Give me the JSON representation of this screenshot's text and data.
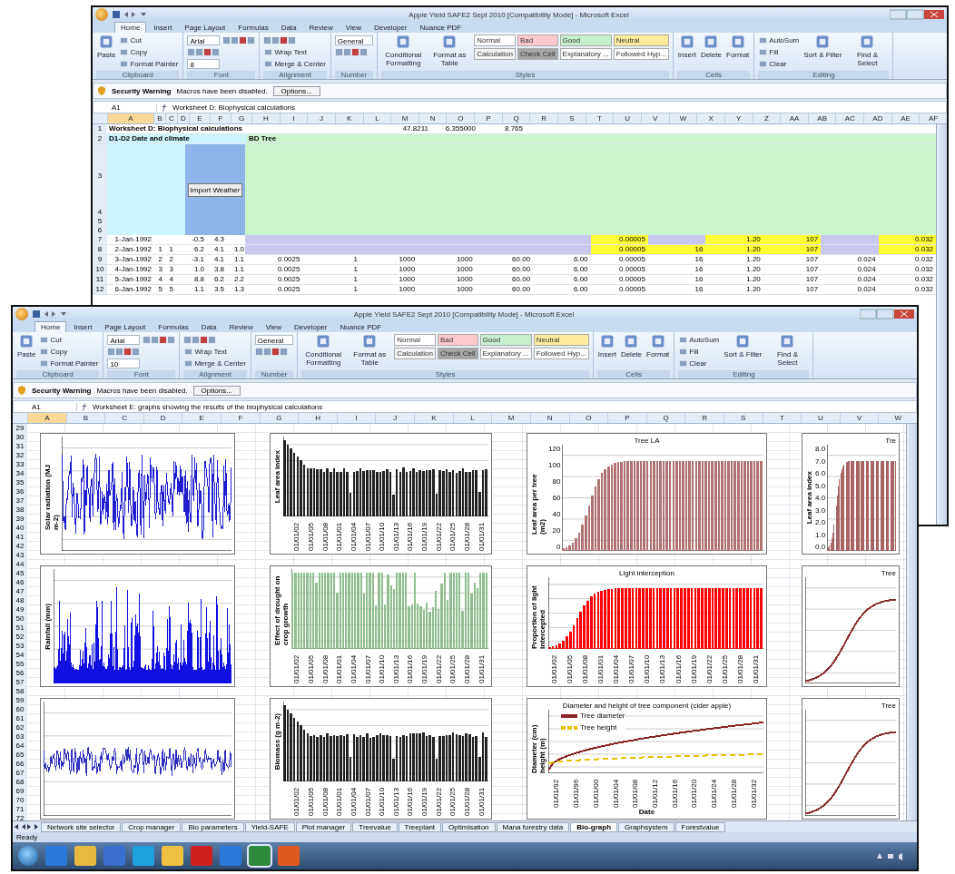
{
  "windows": [
    {
      "kind": "worksheet",
      "title": "Apple Yield SAFE2 Sept 2010 [Compatibility Mode] - Microsoft Excel",
      "tabs": [
        {
          "label": "Home",
          "selected": true
        },
        {
          "label": "Insert",
          "selected": false
        },
        {
          "label": "Page Layout",
          "selected": false
        },
        {
          "label": "Formulas",
          "selected": false
        },
        {
          "label": "Data",
          "selected": false
        },
        {
          "label": "Review",
          "selected": false
        },
        {
          "label": "View",
          "selected": false
        },
        {
          "label": "Developer",
          "selected": false
        },
        {
          "label": "Nuance PDF",
          "selected": false
        }
      ],
      "ribbon": [
        {
          "label": "Clipboard",
          "items": [
            {
              "kind": "big",
              "text": "Paste"
            },
            {
              "kind": "small",
              "text": "Cut"
            },
            {
              "kind": "small",
              "text": "Copy"
            },
            {
              "kind": "small",
              "text": "Format Painter"
            }
          ]
        },
        {
          "label": "Font",
          "items": [
            {
              "kind": "field",
              "text": "Arial"
            },
            {
              "kind": "small"
            },
            {
              "kind": "field",
              "text": "8"
            },
            {
              "kind": "small"
            }
          ]
        },
        {
          "label": "Alignment",
          "items": [
            {
              "kind": "small"
            },
            {
              "kind": "small",
              "text": "Wrap Text"
            },
            {
              "kind": "small",
              "text": "Merge & Center"
            }
          ]
        },
        {
          "label": "Number",
          "items": [
            {
              "kind": "field",
              "text": "General"
            },
            {
              "kind": "small"
            }
          ]
        },
        {
          "label": "Styles",
          "items": [
            {
              "kind": "big",
              "text": "Conditional Formatting"
            },
            {
              "kind": "big",
              "text": "Format as Table"
            }
          ],
          "styles": [
            {
              "text": "Normal",
              "color": "#ffffff"
            },
            {
              "text": "Bad",
              "color": "#ffc7ce"
            },
            {
              "text": "Good",
              "color": "#c6efce"
            },
            {
              "text": "Neutral",
              "color": "#ffeb9c"
            },
            {
              "text": "Calculation",
              "color": "#f2f2f2"
            },
            {
              "text": "Check Cell",
              "color": "#a5a5a5"
            },
            {
              "text": "Explanatory ...",
              "color": "#fafafa"
            },
            {
              "text": "Followed Hyp...",
              "color": "#fdfdfd"
            }
          ]
        },
        {
          "label": "Cells",
          "items": [
            {
              "kind": "big",
              "text": "Insert"
            },
            {
              "kind": "big",
              "text": "Delete"
            },
            {
              "kind": "big",
              "text": "Format"
            }
          ]
        },
        {
          "label": "Editing",
          "items": [
            {
              "kind": "small",
              "text": "AutoSum"
            },
            {
              "kind": "small",
              "text": "Fill"
            },
            {
              "kind": "small",
              "text": "Clear"
            },
            {
              "kind": "big",
              "text": "Sort & Filter"
            },
            {
              "kind": "big",
              "text": "Find & Select"
            }
          ]
        }
      ],
      "security": {
        "title": "Security Warning",
        "message": "Macros have been disabled.",
        "button": "Options..."
      },
      "name_box": "A1",
      "formula": "Worksheet D: Biophysical calculations",
      "columns": [
        "A",
        "B",
        "C",
        "D",
        "E",
        "F",
        "G",
        "H",
        "I",
        "J",
        "K",
        "L",
        "M",
        "N",
        "O",
        "P",
        "Q",
        "R",
        "S",
        "T",
        "U",
        "V",
        "W",
        "X",
        "Y",
        "Z",
        "AA",
        "AB",
        "AC",
        "AD",
        "AE",
        "AF"
      ],
      "sheet": {
        "header_row_numbers": [
          "1",
          "2",
          "3",
          "4",
          "5",
          "6"
        ],
        "title": "Worksheet D: Biophysical calculations",
        "totals": [
          "47.8211",
          "6.355000",
          "8.765"
        ],
        "climate_heading": "D1-D2 Date and climate",
        "tree_heading": "BD Tree",
        "import_button": "Import Weather",
        "rows": [
          {
            "number": "7",
            "date": "1-Jan-1992",
            "temp": "-0.5",
            "rad": "4.3",
            "highlight": true,
            "tree": {
              "column_7": "0.00005",
              "column_9": "1.20",
              "column_10": "107",
              "column_12": "0.032"
            }
          },
          {
            "number": "8",
            "date": "2-Jan-1992",
            "day": "1",
            "doy": "1",
            "temp": "6.2",
            "rad": "4.1",
            "precip": "1.0",
            "highlight": true,
            "tree": {
              "column_7": "0.00005",
              "column_8": "16",
              "column_9": "1.20",
              "column_10": "107",
              "column_12": "0.032"
            }
          },
          {
            "number": "9",
            "date": "3-Jan-1992",
            "day": "2",
            "doy": "2",
            "temp": "-3.1",
            "rad": "4.1",
            "precip": "1.1",
            "highlight": false,
            "tree": {
              "column_1": "0.0025",
              "column_2": "1",
              "column_3": "1000",
              "column_4": "1000",
              "column_5": "60.00",
              "column_6": "6.00",
              "column_7": "0.00005",
              "column_8": "16",
              "column_9": "1.20",
              "column_10": "107",
              "column_11": "0.024",
              "column_12": "0.032"
            }
          },
          {
            "number": "10",
            "date": "4-Jan-1992",
            "day": "3",
            "doy": "3",
            "temp": "1.0",
            "rad": "3.8",
            "precip": "1.1",
            "highlight": false,
            "tree": {
              "column_1": "0.0025",
              "column_2": "1",
              "column_3": "1000",
              "column_4": "1000",
              "column_5": "60.00",
              "column_6": "6.00",
              "column_7": "0.00005",
              "column_8": "16",
              "column_9": "1.20",
              "column_10": "107",
              "column_11": "0.024",
              "column_12": "0.032"
            }
          },
          {
            "number": "11",
            "date": "5-Jan-1992",
            "day": "4",
            "doy": "4",
            "temp": "8.8",
            "rad": "6.2",
            "precip": "2.2",
            "highlight": false,
            "tree": {
              "column_1": "0.0025",
              "column_2": "1",
              "column_3": "1000",
              "column_4": "1000",
              "column_5": "60.00",
              "column_6": "6.00",
              "column_7": "0.00005",
              "column_8": "16",
              "column_9": "1.20",
              "column_10": "107",
              "column_11": "0.024",
              "column_12": "0.032"
            }
          },
          {
            "number": "12",
            "date": "6-Jan-1992",
            "day": "5",
            "doy": "5",
            "temp": "1.1",
            "rad": "3.5",
            "precip": "1.3",
            "highlight": false,
            "tree": {
              "column_1": "0.0025",
              "column_2": "1",
              "column_3": "1000",
              "column_4": "1000",
              "column_5": "60.00",
              "column_6": "6.00",
              "column_7": "0.00005",
              "column_8": "16",
              "column_9": "1.20",
              "column_10": "107",
              "column_11": "0.024",
              "column_12": "0.032"
            }
          }
        ]
      }
    },
    {
      "kind": "graphs",
      "title": "Apple Yield SAFE2 Sept 2010 [Compatibility Mode] - Microsoft Excel",
      "tabs": [
        {
          "label": "Home",
          "selected": true
        },
        {
          "label": "Insert",
          "selected": false
        },
        {
          "label": "Page Layout",
          "selected": false
        },
        {
          "label": "Formulas",
          "selected": false
        },
        {
          "label": "Data",
          "selected": false
        },
        {
          "label": "Review",
          "selected": false
        },
        {
          "label": "View",
          "selected": false
        },
        {
          "label": "Developer",
          "selected": false
        },
        {
          "label": "Nuance PDF",
          "selected": false
        }
      ],
      "ribbon": [
        {
          "label": "Clipboard",
          "items": [
            {
              "kind": "big",
              "text": "Paste"
            },
            {
              "kind": "small",
              "text": "Cut"
            },
            {
              "kind": "small",
              "text": "Copy"
            },
            {
              "kind": "small",
              "text": "Format Painter"
            }
          ]
        },
        {
          "label": "Font",
          "items": [
            {
              "kind": "field",
              "text": "Arial"
            },
            {
              "kind": "small"
            },
            {
              "kind": "field",
              "text": "10"
            },
            {
              "kind": "small"
            }
          ]
        },
        {
          "label": "Alignment",
          "items": [
            {
              "kind": "small"
            },
            {
              "kind": "small",
              "text": "Wrap Text"
            },
            {
              "kind": "small",
              "text": "Merge & Center"
            }
          ]
        },
        {
          "label": "Number",
          "items": [
            {
              "kind": "field",
              "text": "General"
            },
            {
              "kind": "small"
            }
          ]
        },
        {
          "label": "Styles",
          "items": [
            {
              "kind": "big",
              "text": "Conditional Formatting"
            },
            {
              "kind": "big",
              "text": "Format as Table"
            }
          ],
          "styles": [
            {
              "text": "Normal",
              "color": "#ffffff"
            },
            {
              "text": "Bad",
              "color": "#ffc7ce"
            },
            {
              "text": "Good",
              "color": "#c6efce"
            },
            {
              "text": "Neutral",
              "color": "#ffeb9c"
            },
            {
              "text": "Calculation",
              "color": "#f2f2f2"
            },
            {
              "text": "Check Cell",
              "color": "#a5a5a5"
            },
            {
              "text": "Explanatory ...",
              "color": "#fafafa"
            },
            {
              "text": "Followed Hyp...",
              "color": "#fdfdfd"
            }
          ]
        },
        {
          "label": "Cells",
          "items": [
            {
              "kind": "big",
              "text": "Insert"
            },
            {
              "kind": "big",
              "text": "Delete"
            },
            {
              "kind": "big",
              "text": "Format"
            }
          ]
        },
        {
          "label": "Editing",
          "items": [
            {
              "kind": "small",
              "text": "AutoSum"
            },
            {
              "kind": "small",
              "text": "Fill"
            },
            {
              "kind": "small",
              "text": "Clear"
            },
            {
              "kind": "big",
              "text": "Sort & Filter"
            },
            {
              "kind": "big",
              "text": "Find & Select"
            }
          ]
        }
      ],
      "security": {
        "title": "Security Warning",
        "message": "Macros have been disabled.",
        "button": "Options..."
      },
      "name_box": "A1",
      "formula": "Worksheet E: graphs showing the results of the biophysical calculations",
      "columns": [
        "A",
        "B",
        "C",
        "D",
        "E",
        "F",
        "G",
        "H",
        "I",
        "J",
        "K",
        "L",
        "M",
        "N",
        "O",
        "P",
        "Q",
        "R",
        "S",
        "T",
        "U",
        "V",
        "W"
      ],
      "row_numbers": [
        "29",
        "30",
        "31",
        "32",
        "33",
        "34",
        "35",
        "36",
        "37",
        "38",
        "39",
        "40",
        "41",
        "42",
        "43",
        "44",
        "45",
        "46",
        "47",
        "48",
        "49",
        "50",
        "51",
        "52",
        "53",
        "54",
        "55",
        "56",
        "57",
        "58",
        "59",
        "60",
        "61",
        "62",
        "63",
        "64",
        "65",
        "66",
        "67",
        "68",
        "69",
        "70",
        "71",
        "72"
      ],
      "charts": [
        {
          "kind": "noisy-line",
          "color": "#1f1fd0",
          "ylabel": "Solar radiation (MJ m-2)"
        },
        {
          "kind": "bars",
          "color": "#222222",
          "ylabel": "Leaf area index",
          "x_labels": [
            "01/01/02",
            "01/01/05",
            "01/01/08",
            "01/01/01",
            "01/01/04",
            "01/01/07",
            "01/01/10",
            "01/01/13",
            "01/01/16",
            "01/01/19",
            "01/01/22",
            "01/01/25",
            "01/01/28",
            "01/01/31"
          ]
        },
        {
          "kind": "growth-bars",
          "color": "#b07272",
          "title": "Tree LA",
          "ylabel": "Leaf area per tree (m2)",
          "y_ticks": [
            "120",
            "100",
            "80",
            "60",
            "40",
            "20",
            "0"
          ]
        },
        {
          "kind": "growth-bars",
          "color": "#a86464",
          "title": "Tre",
          "ylabel": "Leaf area index",
          "y_ticks": [
            "8.0",
            "7.0",
            "6.0",
            "5.0",
            "4.0",
            "3.0",
            "2.0",
            "1.0",
            "0.0"
          ]
        },
        {
          "kind": "spiky-line",
          "color": "#1010e0",
          "ylabel": "Rainfall (mm)"
        },
        {
          "kind": "dense-bars",
          "color": "#8fbf8f",
          "ylabel": "Effect of drought on crop growth",
          "x_labels": [
            "01/01/02",
            "01/01/05",
            "01/01/08",
            "01/01/01",
            "01/01/04",
            "01/01/07",
            "01/01/10",
            "01/01/13",
            "01/01/16",
            "01/01/19",
            "01/01/22",
            "01/01/25",
            "01/01/28",
            "01/01/31"
          ]
        },
        {
          "kind": "growth-bars",
          "color": "#ff0000",
          "title": "Light interception",
          "ylabel": "Proportion of light intercepted",
          "x_labels": [
            "01/01/02",
            "01/01/05",
            "01/01/08",
            "01/01/01",
            "01/01/04",
            "01/01/07",
            "01/01/10",
            "01/01/13",
            "01/01/16",
            "01/01/19",
            "01/01/22",
            "01/01/25",
            "01/01/28",
            "01/01/31"
          ]
        },
        {
          "kind": "growth-line",
          "color": "#8b3030",
          "title": "Tree"
        },
        {
          "kind": "noisy-band",
          "color": "#3030c0"
        },
        {
          "kind": "bars",
          "color": "#222222",
          "ylabel": "Biomass (g m-2)",
          "x_labels": [
            "01/01/02",
            "01/01/05",
            "01/01/08",
            "01/01/01",
            "01/01/04",
            "01/01/07",
            "01/01/10",
            "01/01/13",
            "01/01/16",
            "01/01/19",
            "01/01/22",
            "01/01/25",
            "01/01/28",
            "01/01/31"
          ]
        },
        {
          "kind": "two-lines",
          "title": "Diameter and height of tree component (cider apple)",
          "ylabel": "Diameter (cm) height (m)",
          "xlabel": "Date",
          "legend": [
            {
              "label": "Tree diameter",
              "color": "#8b2525",
              "dashed": false
            },
            {
              "label": "Tree height",
              "color": "#e6c200",
              "dashed": true
            }
          ],
          "x_labels": [
            "01/01/92",
            "01/01/96",
            "01/01/00",
            "01/01/04",
            "01/01/08",
            "01/01/12",
            "01/01/16",
            "01/01/20",
            "01/01/24",
            "01/01/28",
            "01/01/32"
          ]
        },
        {
          "kind": "growth-line",
          "color": "#8b3030",
          "title": "Tree"
        }
      ],
      "sheet_tabs": [
        {
          "label": "Network site selector",
          "selected": false
        },
        {
          "label": "Crop manager",
          "selected": false
        },
        {
          "label": "Bio parameters",
          "selected": false
        },
        {
          "label": "Yield-SAFE",
          "selected": false
        },
        {
          "label": "Plot manager",
          "selected": false
        },
        {
          "label": "Treevalue",
          "selected": false
        },
        {
          "label": "Treeplant",
          "selected": false
        },
        {
          "label": "Optimisation",
          "selected": false
        },
        {
          "label": "Mana forestry data",
          "selected": false
        },
        {
          "label": "Bio-graph",
          "selected": true
        },
        {
          "label": "Graphsystem",
          "selected": false
        },
        {
          "label": "Forestvalue",
          "selected": false
        }
      ],
      "status": "Ready",
      "taskbar_apps": [
        {
          "kind": "browser",
          "selected": false
        },
        {
          "kind": "folder",
          "selected": false
        },
        {
          "kind": "media",
          "selected": false
        },
        {
          "kind": "phone",
          "selected": false
        },
        {
          "kind": "mail",
          "selected": false
        },
        {
          "kind": "pdf",
          "selected": false
        },
        {
          "kind": "browser",
          "selected": false
        },
        {
          "kind": "spreadsheet",
          "selected": true
        },
        {
          "kind": "presentation",
          "selected": false
        }
      ]
    }
  ]
}
